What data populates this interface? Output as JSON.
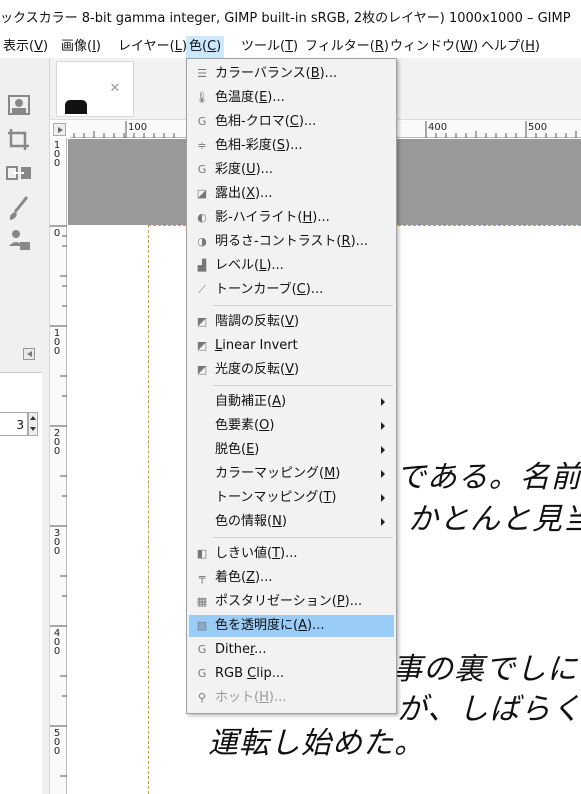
{
  "window": {
    "title": "ックスカラー 8-bit gamma integer, GIMP built-in sRGB, 2枚のレイヤー) 1000x1000 – GIMP"
  },
  "menubar": [
    {
      "label": "表示(",
      "mnemonic": "V",
      "suffix": ")"
    },
    {
      "label": "画像(",
      "mnemonic": "I",
      "suffix": ")"
    },
    {
      "label": "レイヤー(",
      "mnemonic": "L",
      "suffix": ")"
    },
    {
      "label": "色(",
      "mnemonic": "C",
      "suffix": ")"
    },
    {
      "label": "ツール(",
      "mnemonic": "T",
      "suffix": ")"
    },
    {
      "label": "フィルター(",
      "mnemonic": "R",
      "suffix": ")"
    },
    {
      "label": "ウィンドウ(",
      "mnemonic": "W",
      "suffix": ")"
    },
    {
      "label": "ヘルプ(",
      "mnemonic": "H",
      "suffix": ")"
    }
  ],
  "active_menu": "色(C)",
  "colors_menu": {
    "items": [
      {
        "label": "カラーバランス(",
        "mnemonic": "B",
        "suffix": ")...",
        "icon": "color-balance-icon"
      },
      {
        "label": "色温度(",
        "mnemonic": "E",
        "suffix": ")...",
        "icon": "color-temperature-icon"
      },
      {
        "label": "色相-クロマ(",
        "mnemonic": "C",
        "suffix": ")...",
        "icon": "hue-chroma-icon"
      },
      {
        "label": "色相-彩度(",
        "mnemonic": "S",
        "suffix": ")...",
        "icon": "hue-saturation-icon"
      },
      {
        "label": "彩度(",
        "mnemonic": "U",
        "suffix": ")...",
        "icon": "saturation-icon"
      },
      {
        "label": "露出(",
        "mnemonic": "X",
        "suffix": ")...",
        "icon": "exposure-icon"
      },
      {
        "label": "影-ハイライト(",
        "mnemonic": "H",
        "suffix": ")...",
        "icon": "shadows-highlights-icon"
      },
      {
        "label": "明るさ-コントラスト(",
        "mnemonic": "R",
        "suffix": ")...",
        "icon": "brightness-contrast-icon"
      },
      {
        "label": "レベル(",
        "mnemonic": "L",
        "suffix": ")...",
        "icon": "levels-icon"
      },
      {
        "label": "トーンカーブ(",
        "mnemonic": "C",
        "suffix": ")...",
        "icon": "curves-icon"
      },
      {
        "label": "階調の反転(",
        "mnemonic": "V",
        "suffix": ")",
        "icon": "invert-icon"
      },
      {
        "label": "",
        "mnemonic": "L",
        "suffix": "inear Invert",
        "icon": "linear-invert-icon"
      },
      {
        "label": "光度の反転(",
        "mnemonic": "V",
        "suffix": ")",
        "icon": "value-invert-icon"
      },
      {
        "label": "自動補正(",
        "mnemonic": "A",
        "suffix": ")",
        "submenu": true
      },
      {
        "label": "色要素(",
        "mnemonic": "O",
        "suffix": ")",
        "submenu": true
      },
      {
        "label": "脱色(",
        "mnemonic": "E",
        "suffix": ")",
        "submenu": true
      },
      {
        "label": "カラーマッピング(",
        "mnemonic": "M",
        "suffix": ")",
        "submenu": true
      },
      {
        "label": "トーンマッピング(",
        "mnemonic": "T",
        "suffix": ")",
        "submenu": true
      },
      {
        "label": "色の情報(",
        "mnemonic": "N",
        "suffix": ")",
        "submenu": true
      },
      {
        "label": "しきい値(",
        "mnemonic": "T",
        "suffix": ")...",
        "icon": "threshold-icon"
      },
      {
        "label": "着色(",
        "mnemonic": "Z",
        "suffix": ")...",
        "icon": "colorize-icon"
      },
      {
        "label": "ポスタリゼーション(",
        "mnemonic": "P",
        "suffix": ")...",
        "icon": "posterize-icon"
      },
      {
        "label": "色を透明度に(",
        "mnemonic": "A",
        "suffix": ")...",
        "icon": "color-to-alpha-icon",
        "highlighted": true
      },
      {
        "label": "Dithe",
        "mnemonic": "r",
        "suffix": "...",
        "icon": "dither-icon"
      },
      {
        "label": "RGB ",
        "mnemonic": "C",
        "suffix": "lip...",
        "icon": "rgb-clip-icon"
      },
      {
        "label": "ホット(",
        "mnemonic": "H",
        "suffix": ")...",
        "icon": "hot-icon",
        "disabled": true
      }
    ]
  },
  "rulers": {
    "horizontal": [
      "100",
      "400",
      "500"
    ],
    "vertical": [
      "1\n0\n0",
      "0",
      "1\n0\n0",
      "2\n0\n0",
      "3\n0\n0",
      "4\n0\n0",
      "5\n0\n0"
    ]
  },
  "tool_options": {
    "spin_value": "3"
  },
  "canvas_text": [
    "である。名前し",
    "かとんと見当",
    "事の裏でしに",
    "が、しばらくする",
    "運転し始めた。"
  ],
  "colors": {
    "menu_bg": "#f2f2f2",
    "highlight": "#99ccf7",
    "active_menubar": "#cce8ff",
    "canvas_padding": "#999999",
    "guide": "#c9a800"
  }
}
